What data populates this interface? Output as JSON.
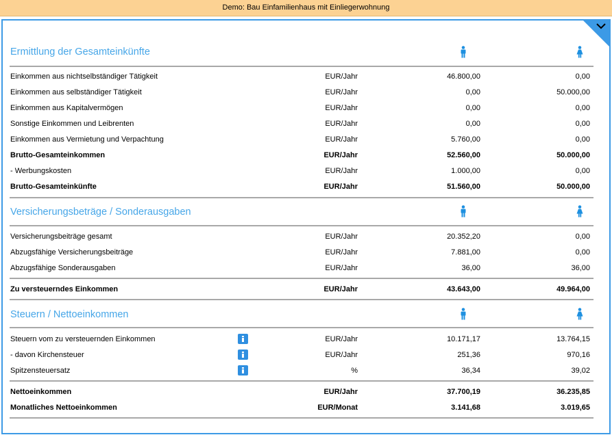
{
  "window": {
    "title": "Demo: Bau Einfamilienhaus mit Einliegerwohnung"
  },
  "colors": {
    "accent": "#3c9ae6",
    "section_title": "#46a6e8",
    "titlebar": "#fcd293"
  },
  "icons": {
    "person1": "male-person-icon",
    "person2": "female-person-icon",
    "info": "info-icon",
    "expand": "chevron-down-icon"
  },
  "sections": [
    {
      "title": "Ermittlung der Gesamteinkünfte",
      "rows": [
        {
          "label": "Einkommen aus nichtselbständiger Tätigkeit",
          "unit": "EUR/Jahr",
          "v1": "46.800,00",
          "v2": "0,00"
        },
        {
          "label": "Einkommen aus selbständiger Tätigkeit",
          "unit": "EUR/Jahr",
          "v1": "0,00",
          "v2": "50.000,00"
        },
        {
          "label": "Einkommen aus Kapitalvermögen",
          "unit": "EUR/Jahr",
          "v1": "0,00",
          "v2": "0,00"
        },
        {
          "label": "Sonstige Einkommen und Leibrenten",
          "unit": "EUR/Jahr",
          "v1": "0,00",
          "v2": "0,00"
        },
        {
          "label": "Einkommen aus Vermietung und Verpachtung",
          "unit": "EUR/Jahr",
          "v1": "5.760,00",
          "v2": "0,00"
        },
        {
          "label": "Brutto-Gesamteinkommen",
          "unit": "EUR/Jahr",
          "v1": "52.560,00",
          "v2": "50.000,00"
        },
        {
          "label": "- Werbungskosten",
          "unit": "EUR/Jahr",
          "v1": "1.000,00",
          "v2": "0,00"
        },
        {
          "label": "Brutto-Gesamteinkünfte",
          "unit": "EUR/Jahr",
          "v1": "51.560,00",
          "v2": "50.000,00"
        }
      ]
    },
    {
      "title": "Versicherungsbeträge / Sonderausgaben",
      "rows": [
        {
          "label": "Versicherungsbeiträge gesamt",
          "unit": "EUR/Jahr",
          "v1": "20.352,20",
          "v2": "0,00"
        },
        {
          "label": "Abzugsfähige Versicherungsbeiträge",
          "unit": "EUR/Jahr",
          "v1": "7.881,00",
          "v2": "0,00"
        },
        {
          "label": "Abzugsfähige Sonderausgaben",
          "unit": "EUR/Jahr",
          "v1": "36,00",
          "v2": "36,00"
        },
        {
          "label": "Zu versteuerndes Einkommen",
          "unit": "EUR/Jahr",
          "v1": "43.643,00",
          "v2": "49.964,00"
        }
      ]
    },
    {
      "title": "Steuern / Nettoeinkommen",
      "rows": [
        {
          "label": "Steuern vom zu versteuernden Einkommen",
          "unit": "EUR/Jahr",
          "v1": "10.171,17",
          "v2": "13.764,15"
        },
        {
          "label": "- davon Kirchensteuer",
          "unit": "EUR/Jahr",
          "v1": "251,36",
          "v2": "970,16"
        },
        {
          "label": "Spitzensteuersatz",
          "unit": "%",
          "v1": "36,34",
          "v2": "39,02"
        },
        {
          "label": "Nettoeinkommen",
          "unit": "EUR/Jahr",
          "v1": "37.700,19",
          "v2": "36.235,85"
        },
        {
          "label": "Monatliches Nettoeinkommen",
          "unit": "EUR/Monat",
          "v1": "3.141,68",
          "v2": "3.019,65"
        }
      ]
    }
  ]
}
